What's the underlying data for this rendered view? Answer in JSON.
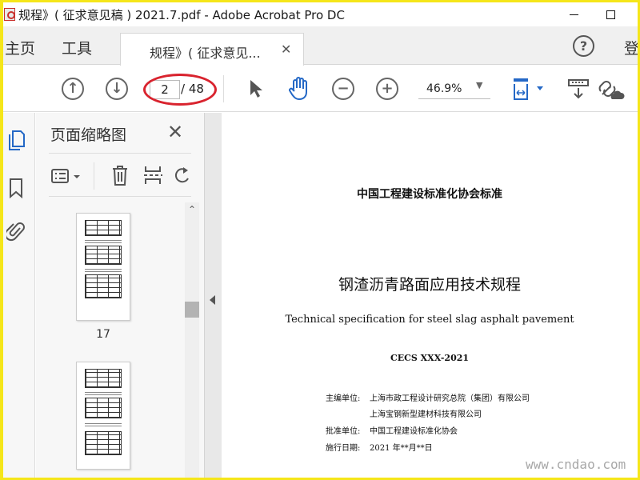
{
  "window": {
    "title": "规程》( 征求意见稿 ) 2021.7.pdf - Adobe Acrobat Pro DC"
  },
  "tabs": {
    "home": "主页",
    "tools": "工具",
    "document": "规程》( 征求意见...",
    "close": "✕",
    "help": "?",
    "signin": "登"
  },
  "toolbar": {
    "current_page": "2",
    "total_pages": "/ 48",
    "zoom": "46.9%"
  },
  "thumbnails": {
    "title": "页面缩略图",
    "close": "✕",
    "pages": [
      {
        "label": "17"
      },
      {
        "label": ""
      }
    ]
  },
  "document": {
    "org": "中国工程建设标准化协会标准",
    "title_cn": "钢渣沥青路面应用技术规程",
    "title_en": "Technical specification for steel slag asphalt pavement",
    "code": "CECS XXX-2021",
    "editor_label": "主编单位:",
    "editor_1": "上海市政工程设计研究总院（集团）有限公司",
    "editor_2": "上海宝钢新型建材科技有限公司",
    "approver_label": "批准单位:",
    "approver": "中国工程建设标准化协会",
    "date_label": "施行日期:",
    "date": "2021 年**月**日"
  },
  "watermark": "www.cndao.com",
  "colors": {
    "accent_blue": "#2468c6",
    "highlight_red": "#d9232e",
    "border_yellow": "#f5e61a"
  }
}
